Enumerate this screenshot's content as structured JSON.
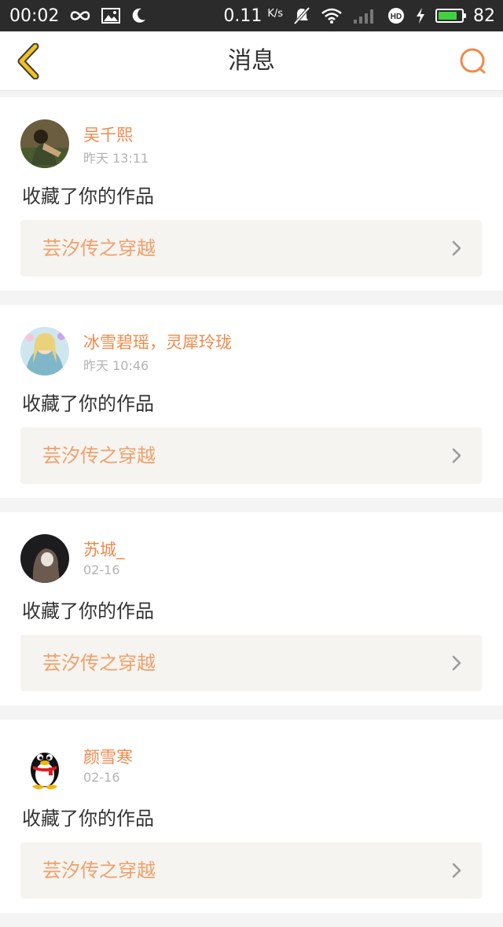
{
  "status_bar": {
    "time": "00:02",
    "speed": "0.11",
    "speed_unit": "K/s",
    "battery": "82",
    "battery_fraction": 0.82,
    "icons": [
      "infinity-icon",
      "image-icon",
      "moon-icon",
      "mute-icon",
      "wifi-icon",
      "signal-icon",
      "hd-icon",
      "charging-icon",
      "battery-icon"
    ]
  },
  "header": {
    "title": "消息",
    "back_icon": "chevron-left-icon",
    "search_icon": "search-icon"
  },
  "colors": {
    "accent": "#f08a4b",
    "back_arrow": "#f3c21b",
    "work_bg": "#f5f4f0"
  },
  "messages": [
    {
      "name": "吴千熙",
      "time": "昨天 13:11",
      "action": "收藏了你的作品",
      "work": "芸汐传之穿越",
      "avatar": "photo-avatar"
    },
    {
      "name": "冰雪碧瑶，灵犀玲珑",
      "time": "昨天 10:46",
      "action": "收藏了你的作品",
      "work": "芸汐传之穿越",
      "avatar": "anime-avatar"
    },
    {
      "name": "苏城_",
      "time": "02-16",
      "action": "收藏了你的作品",
      "work": "芸汐传之穿越",
      "avatar": "dark-photo-avatar"
    },
    {
      "name": "颜雪寒",
      "time": "02-16",
      "action": "收藏了你的作品",
      "work": "芸汐传之穿越",
      "avatar": "qq-penguin-avatar"
    }
  ]
}
